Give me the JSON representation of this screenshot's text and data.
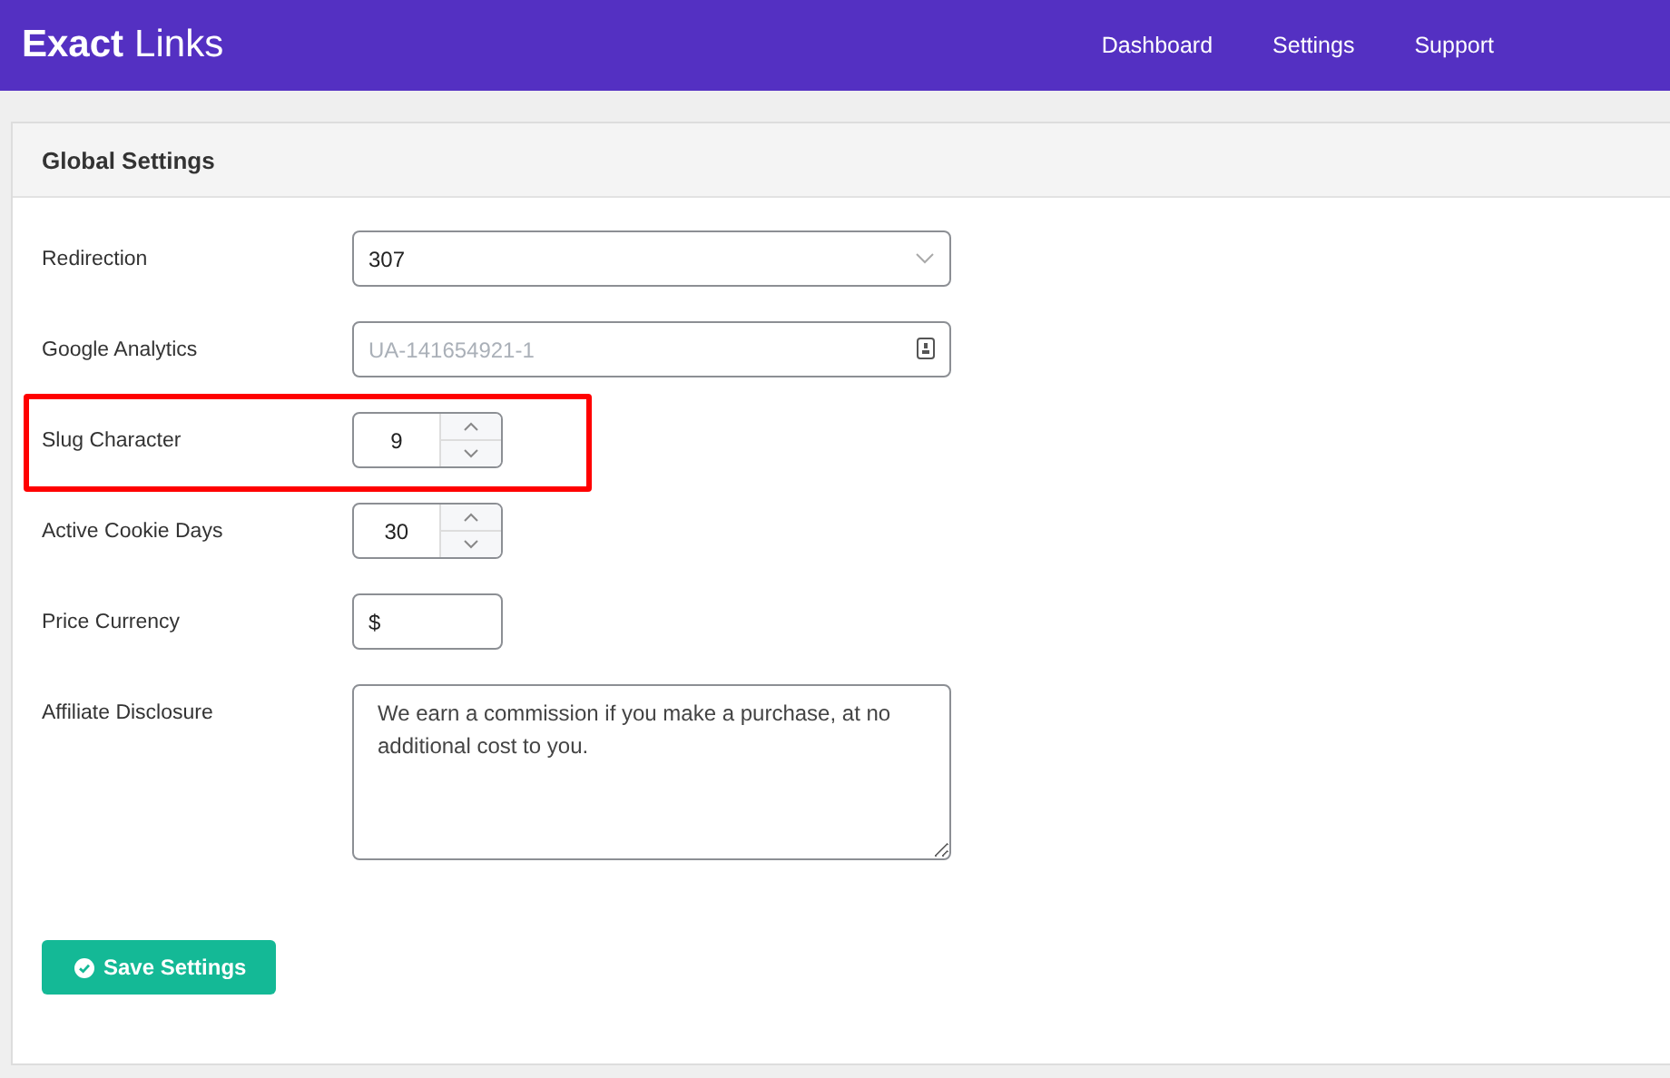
{
  "header": {
    "logo": {
      "bold": "Exact",
      "light": "Links"
    },
    "nav": [
      {
        "label": "Dashboard"
      },
      {
        "label": "Settings"
      },
      {
        "label": "Support"
      }
    ]
  },
  "panel": {
    "title": "Global Settings",
    "fields": [
      {
        "kind": "select",
        "label": "Redirection",
        "value": "307",
        "highlighted": false
      },
      {
        "kind": "text",
        "label": "Google Analytics",
        "placeholder": "UA-141654921-1",
        "highlighted": false
      },
      {
        "kind": "number",
        "label": "Slug Character",
        "value": "9",
        "highlighted": true
      },
      {
        "kind": "number",
        "label": "Active Cookie Days",
        "value": "30",
        "highlighted": false
      },
      {
        "kind": "short",
        "label": "Price Currency",
        "value": "$",
        "highlighted": false
      },
      {
        "kind": "textarea",
        "label": "Affiliate Disclosure",
        "value": "We earn a commission if you make a purchase, at no additional cost to you.",
        "highlighted": false
      }
    ],
    "save_button": "Save Settings"
  }
}
